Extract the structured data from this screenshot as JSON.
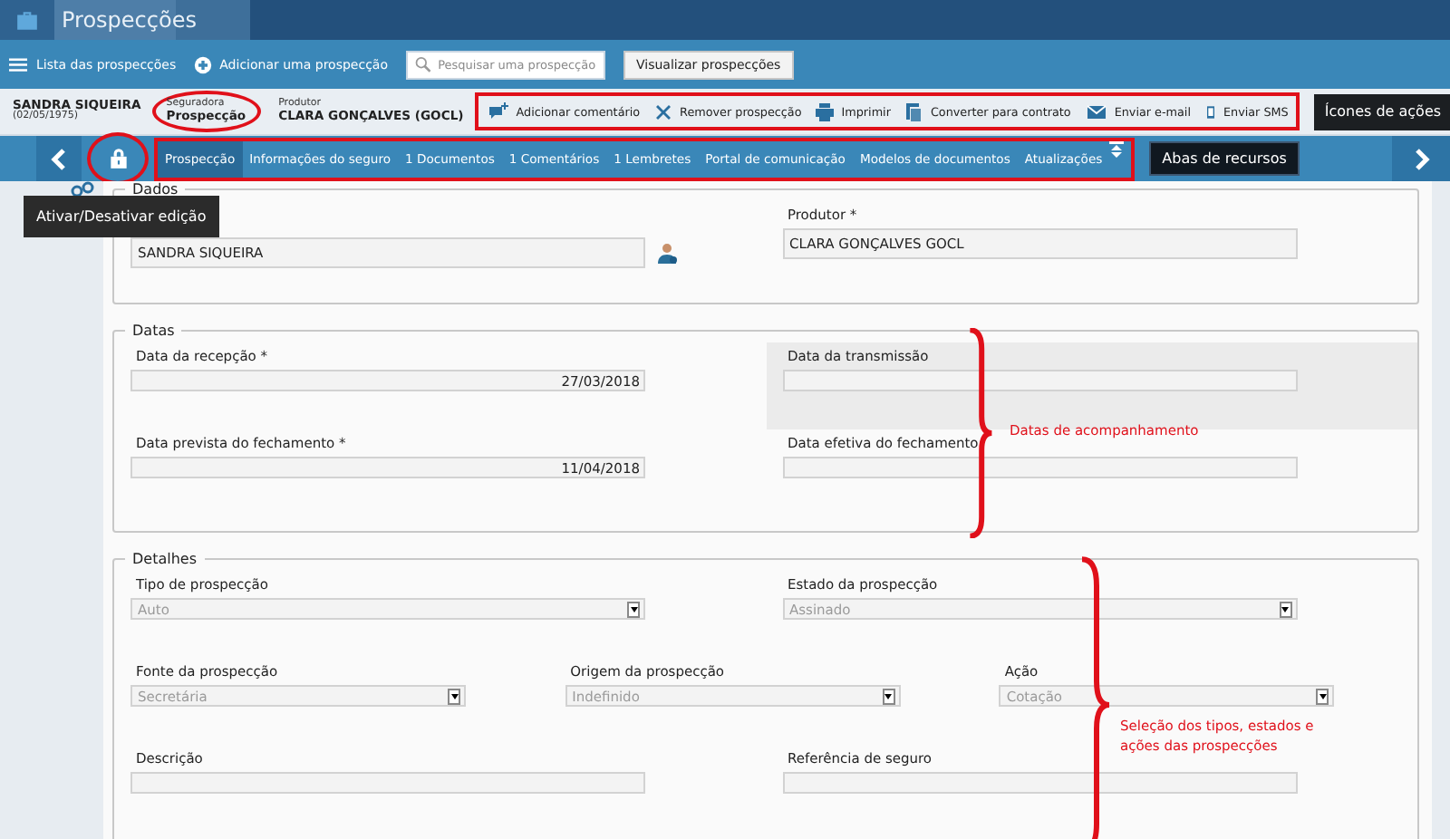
{
  "app_bar": {
    "title": "Prospecções"
  },
  "toolbar": {
    "links": [
      "Lista das prospecções",
      "Adicionar uma prospecção"
    ],
    "search": {
      "placeholder": "Pesquisar uma prospecção"
    },
    "button": "Visualizar prospecções"
  },
  "client": {
    "name": "SANDRA SIQUEIRA",
    "birth": "(02/05/1975)"
  },
  "insurer": {
    "label": "Seguradora",
    "value": "Prospecção"
  },
  "producer": {
    "label": "Produtor",
    "value": "CLARA GONÇALVES (GOCL)"
  },
  "actions": [
    "Adicionar comentário",
    "Remover prospecção",
    "Imprimir",
    "Converter para contrato",
    "Enviar e-mail",
    "Enviar SMS"
  ],
  "tabs": [
    {
      "label": "Prospecção",
      "selected": true
    },
    {
      "label": "Informações do seguro",
      "selected": false
    },
    {
      "label": "1 Documentos",
      "selected": false
    },
    {
      "label": "1 Comentários",
      "selected": false
    },
    {
      "label": "1 Lembretes",
      "selected": false
    },
    {
      "label": "Portal de comunicação",
      "selected": false
    },
    {
      "label": "Modelos de documentos",
      "selected": false
    },
    {
      "label": "Atualizações",
      "selected": false
    }
  ],
  "annotations": {
    "actions": "Ícones de ações",
    "tabs": "Abas de recursos",
    "tooltip": "Ativar/Desativar edição"
  },
  "sections": [
    {
      "title": "Dados",
      "rows": [
        [
          {
            "kind": "client",
            "value": "SANDRA SIQUEIRA",
            "highlighted": false
          },
          {
            "kind": "text",
            "label": "Produtor *",
            "value": "CLARA GONÇALVES GOCL",
            "highlighted": false
          }
        ]
      ]
    },
    {
      "title": "Datas",
      "note": "Datas de acompanhamento",
      "rows": [
        [
          {
            "kind": "date",
            "label": "Data da recepção *",
            "value": "27/03/2018",
            "highlighted": false
          },
          {
            "kind": "date",
            "label": "Data da transmissão",
            "highlighted": true
          }
        ],
        [
          {
            "kind": "date",
            "label": "Data prevista do fechamento *",
            "value": "11/04/2018",
            "highlighted": false
          },
          {
            "kind": "date",
            "label": "Data efetiva do fechamento",
            "highlighted": false
          }
        ]
      ]
    },
    {
      "title": "Detalhes",
      "note": "Seleção dos tipos, estados e ações das prospecções",
      "rows": [
        [
          {
            "kind": "select",
            "label": "Tipo de prospecção",
            "value": "Auto",
            "disabled": true,
            "highlighted": false
          },
          {
            "kind": "select",
            "label": "Estado da prospecção",
            "value": "Assinado",
            "disabled": true,
            "highlighted": false
          }
        ],
        [
          {
            "kind": "select",
            "label": "Fonte da prospecção",
            "value": "Secretária",
            "disabled": true,
            "highlighted": false
          },
          {
            "kind": "select",
            "label": "Origem da prospecção",
            "value": "Indefinido",
            "disabled": true,
            "highlighted": false
          },
          {
            "kind": "select",
            "label": "Ação",
            "value": "Cotação",
            "disabled": true,
            "highlighted": false
          }
        ],
        [
          {
            "kind": "text",
            "label": "Descrição",
            "highlighted": false
          },
          {
            "kind": "text",
            "label": "Referência de seguro",
            "highlighted": false
          }
        ]
      ]
    }
  ]
}
